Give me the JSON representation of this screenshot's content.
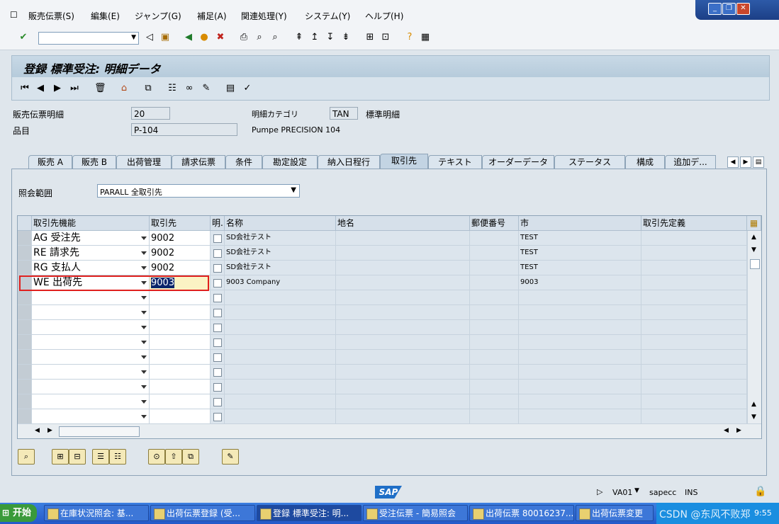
{
  "menu": [
    "販売伝票(S)",
    "編集(E)",
    "ジャンプ(G)",
    "補足(A)",
    "関連処理(Y)",
    "システム(Y)",
    "ヘルプ(H)"
  ],
  "window_controls": {
    "minimize": "_",
    "restore": "❐",
    "close": "✕"
  },
  "title": "登録 標準受注: 明細データ",
  "header": {
    "item_label": "販売伝票明細",
    "item_value": "20",
    "category_label": "明細カテゴリ",
    "category_value": "TAN",
    "category_desc": "標準明細",
    "material_label": "品目",
    "material_value": "P-104",
    "material_desc": "Pumpe PRECISION 104"
  },
  "tabs": [
    "販売 A",
    "販売 B",
    "出荷管理",
    "請求伝票",
    "条件",
    "勘定設定",
    "納入日程行",
    "取引先",
    "テキスト",
    "オーダーデータ",
    "ステータス",
    "構成",
    "追加デ..."
  ],
  "active_tab": "取引先",
  "scope": {
    "label": "照会範囲",
    "value": "PARALL 全取引先"
  },
  "grid": {
    "columns": [
      "取引先機能",
      "取引先",
      "明.",
      "名称",
      "地名",
      "郵便番号",
      "市",
      "取引先定義"
    ],
    "rows": [
      {
        "func": "AG 受注先",
        "partner": "9002",
        "name": "SD会社テスト",
        "city": "TEST"
      },
      {
        "func": "RE 請求先",
        "partner": "9002",
        "name": "SD会社テスト",
        "city": "TEST"
      },
      {
        "func": "RG 支払人",
        "partner": "9002",
        "name": "SD会社テスト",
        "city": "TEST"
      },
      {
        "func": "WE 出荷先",
        "partner": "9003",
        "name": "9003 Company",
        "city": "9003"
      }
    ],
    "empty_rows": 9
  },
  "status": {
    "sap_logo": "SAP",
    "transaction": "VA01",
    "server": "sapecc",
    "mode": "INS"
  },
  "taskbar": {
    "start": "开始",
    "tasks": [
      "在庫状況照会: 基...",
      "出荷伝票登録 (受...",
      "登録 標準受注: 明...",
      "受注伝票 - 簡易照会",
      "出荷伝票 80016237...",
      "出荷伝票変更"
    ],
    "watermark": "CSDN @东风不败郑",
    "clock": "9:55"
  },
  "colors": {
    "highlight_border": "#e0201e",
    "selected_cell": "#0a246a"
  }
}
